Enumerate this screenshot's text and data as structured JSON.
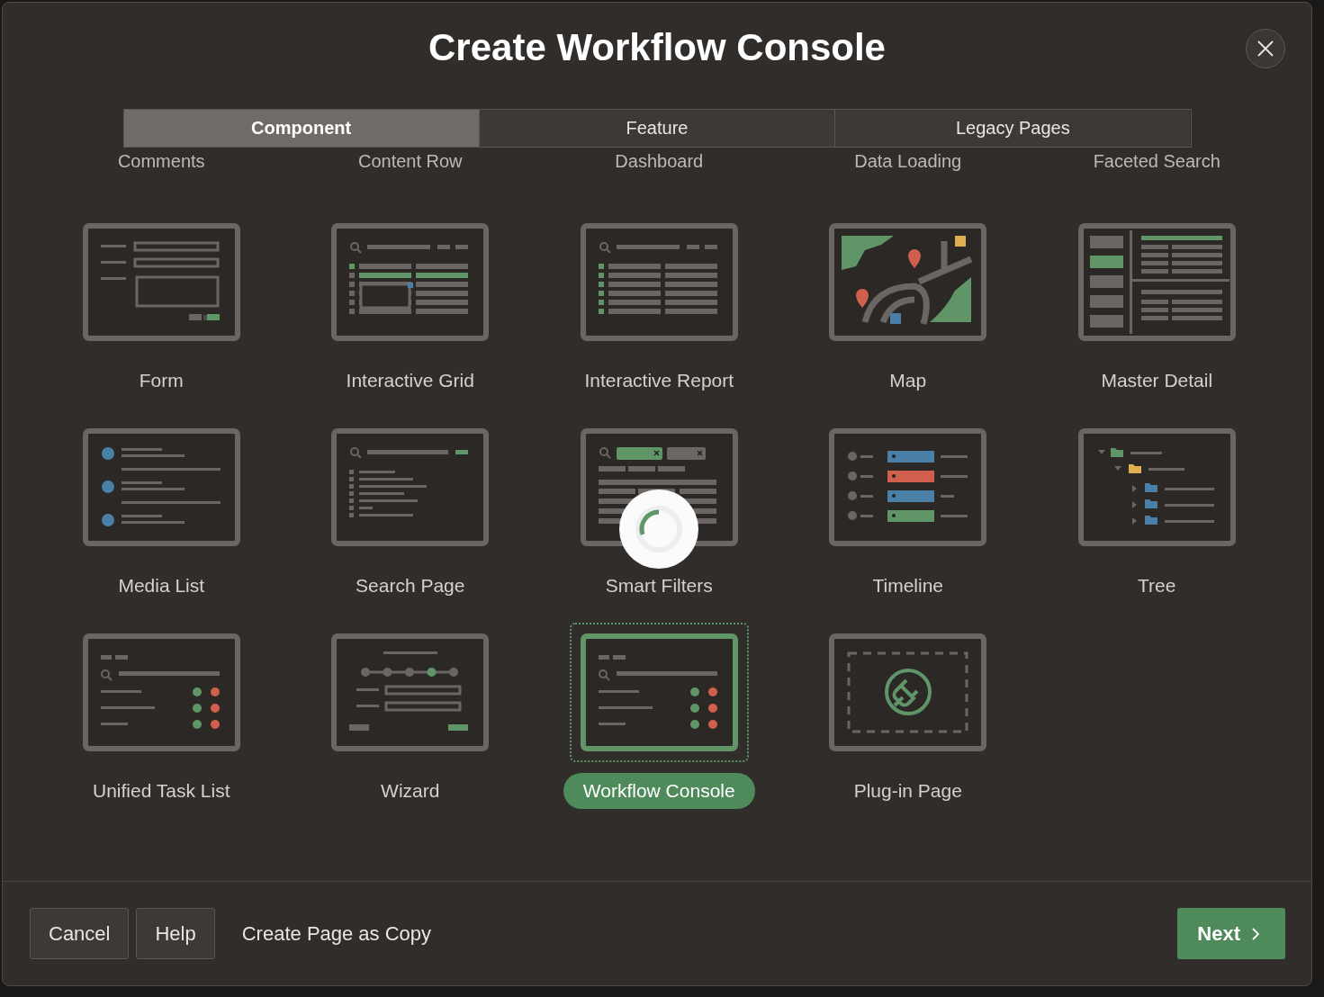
{
  "dialog": {
    "title": "Create Workflow Console"
  },
  "tabs": [
    {
      "label": "Component",
      "selected": true
    },
    {
      "label": "Feature",
      "selected": false
    },
    {
      "label": "Legacy Pages",
      "selected": false
    }
  ],
  "previous_row_labels": [
    "Comments",
    "Content Row",
    "Dashboard",
    "Data Loading",
    "Faceted Search"
  ],
  "templates": [
    {
      "kind": "form",
      "label": "Form",
      "selected": false,
      "loading": false
    },
    {
      "kind": "grid",
      "label": "Interactive Grid",
      "selected": false,
      "loading": false
    },
    {
      "kind": "report",
      "label": "Interactive Report",
      "selected": false,
      "loading": false
    },
    {
      "kind": "map",
      "label": "Map",
      "selected": false,
      "loading": false
    },
    {
      "kind": "master",
      "label": "Master Detail",
      "selected": false,
      "loading": false
    },
    {
      "kind": "media",
      "label": "Media List",
      "selected": false,
      "loading": false
    },
    {
      "kind": "search",
      "label": "Search Page",
      "selected": false,
      "loading": false
    },
    {
      "kind": "filters",
      "label": "Smart Filters",
      "selected": false,
      "loading": true
    },
    {
      "kind": "timeline",
      "label": "Timeline",
      "selected": false,
      "loading": false
    },
    {
      "kind": "tree",
      "label": "Tree",
      "selected": false,
      "loading": false
    },
    {
      "kind": "tasks",
      "label": "Unified Task List",
      "selected": false,
      "loading": false
    },
    {
      "kind": "wizard",
      "label": "Wizard",
      "selected": false,
      "loading": false
    },
    {
      "kind": "tasks",
      "label": "Workflow Console",
      "selected": true,
      "loading": false
    },
    {
      "kind": "plugin",
      "label": "Plug-in Page",
      "selected": false,
      "loading": false
    }
  ],
  "footer": {
    "cancel": "Cancel",
    "help": "Help",
    "copy_link": "Create Page as Copy",
    "next": "Next"
  }
}
